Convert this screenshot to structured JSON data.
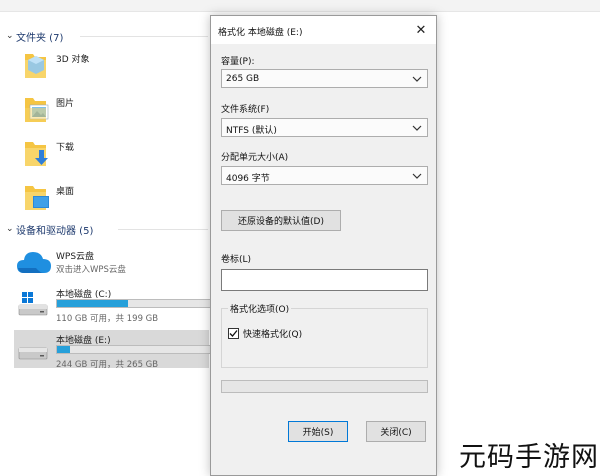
{
  "explorer": {
    "folders_header": "文件夹 (7)",
    "folders": [
      {
        "label": "3D 对象",
        "icon": "3d-objects-folder-icon"
      },
      {
        "label": "图片",
        "icon": "pictures-folder-icon"
      },
      {
        "label": "下载",
        "icon": "downloads-folder-icon"
      },
      {
        "label": "桌面",
        "icon": "desktop-folder-icon"
      }
    ],
    "devices_header": "设备和驱动器 (5)",
    "wps": {
      "name": "WPS云盘",
      "sub": "双击进入WPS云盘",
      "icon": "cloud-icon"
    },
    "drives": [
      {
        "name": "本地磁盘 (C:)",
        "sub": "110 GB 可用，共 199 GB",
        "usage": 0.45,
        "icon": "windows-drive-icon",
        "selected": false
      },
      {
        "name": "本地磁盘 (E:)",
        "sub": "244 GB 可用，共 265 GB",
        "usage": 0.08,
        "icon": "hard-drive-icon",
        "selected": true
      }
    ]
  },
  "dialog": {
    "title": "格式化 本地磁盘 (E:)",
    "close_glyph": "✕",
    "capacity_label": "容量(P):",
    "capacity_value": "265 GB",
    "filesystem_label": "文件系统(F)",
    "filesystem_value": "NTFS (默认)",
    "allocation_label": "分配单元大小(A)",
    "allocation_value": "4096 字节",
    "restore_defaults": "还原设备的默认值(D)",
    "volume_label": "卷标(L)",
    "volume_value": "",
    "format_options_label": "格式化选项(O)",
    "quick_format_label": "快速格式化(Q)",
    "quick_format_checked": true,
    "progress": 0,
    "start_button": "开始(S)",
    "close_button": "关闭(C)"
  },
  "watermark": "元码手游网",
  "colors": {
    "accent": "#0078d7",
    "drive_bar": "#26a0da",
    "header_text": "#1e3a6e",
    "folder_yellow": "#f5c543",
    "selection": "#d9d9d9"
  }
}
